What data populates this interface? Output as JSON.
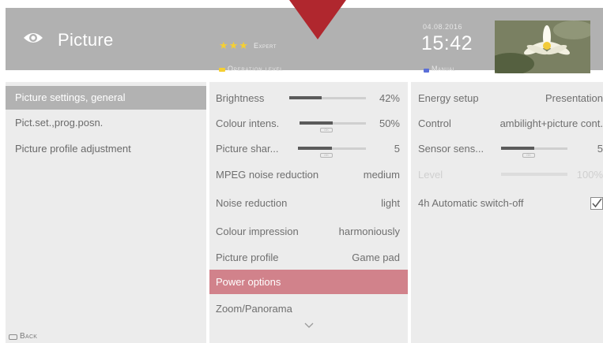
{
  "header": {
    "title": "Picture",
    "stars": "★★★",
    "expert_label": "Expert",
    "operation_level_label": "Operation level",
    "date": "04.08.2016",
    "time": "15:42",
    "mode_label": "Manual"
  },
  "left_menu": {
    "items": [
      {
        "label": "Picture settings, general",
        "active": true
      },
      {
        "label": "Pict.set.,prog.posn.",
        "active": false
      },
      {
        "label": "Picture profile adjustment",
        "active": false
      }
    ],
    "back_label": "Back"
  },
  "middle": {
    "rows": [
      {
        "label": "Brightness",
        "type": "slider",
        "level": 0.42,
        "value": "42%"
      },
      {
        "label": "Colour intens.",
        "type": "slider",
        "level": 0.5,
        "value": "50%"
      },
      {
        "label": "Picture shar...",
        "type": "slider",
        "level": 0.5,
        "value": "5"
      },
      {
        "label": "MPEG noise reduction",
        "type": "value",
        "value": "medium"
      },
      {
        "label": "Noise reduction",
        "type": "value",
        "value": "light"
      },
      {
        "label": "Colour impression",
        "type": "value",
        "value": "harmoniously"
      },
      {
        "label": "Picture profile",
        "type": "value",
        "value": "Game pad"
      },
      {
        "label": "Power options",
        "type": "highlight"
      },
      {
        "label": "Zoom/Panorama",
        "type": "value"
      }
    ]
  },
  "right": {
    "rows": [
      {
        "label": "Energy setup",
        "value": "Presentation"
      },
      {
        "label": "Control",
        "value": "ambilight+picture cont."
      },
      {
        "label": "Sensor sens...",
        "type": "slider",
        "level": 0.5,
        "value": "5"
      },
      {
        "label": "Level",
        "type": "slider",
        "level": 1.0,
        "value": "100%",
        "disabled": true
      },
      {
        "label": "4h Automatic switch-off",
        "type": "checkbox",
        "checked": true
      }
    ]
  },
  "colors": {
    "header_bg": "#b1b1b1",
    "panel_bg": "#ececec",
    "active_item_bg": "#b2b2b2",
    "highlight_row_bg": "#d1828b",
    "pointer": "#b0272e",
    "star": "#f5cf32",
    "manual_indicator": "#5b6fd8"
  },
  "icons": {
    "eye": "eye-icon",
    "pointer": "pointer-icon",
    "checkbox": "checkbox-icon",
    "scroll": "chevron-down-icon",
    "back_key": "back-key-icon"
  }
}
